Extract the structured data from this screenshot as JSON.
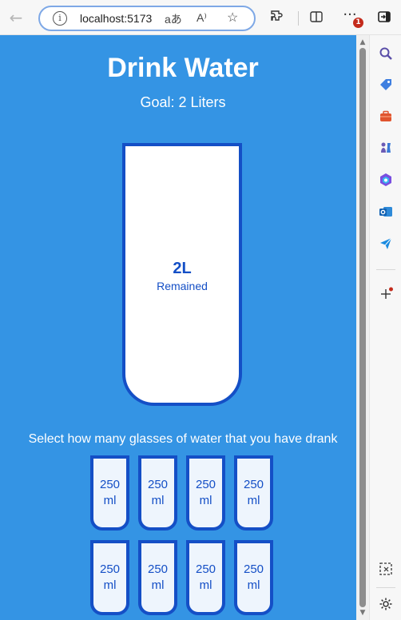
{
  "browser": {
    "url_text": "localhost:5173",
    "read_aloud_icon": "A⁾",
    "translate_icon": "aあ",
    "notification_count": "1",
    "accent_color": "#3494e4"
  },
  "app": {
    "title": "Drink Water",
    "goal": "Goal: 2 Liters",
    "remained_value": "2L",
    "remained_label": "Remained",
    "instruction": "Select how many glasses of water that you have drank",
    "glasses": [
      {
        "line1": "250",
        "line2": "ml"
      },
      {
        "line1": "250",
        "line2": "ml"
      },
      {
        "line1": "250",
        "line2": "ml"
      },
      {
        "line1": "250",
        "line2": "ml"
      },
      {
        "line1": "250",
        "line2": "ml"
      },
      {
        "line1": "250",
        "line2": "ml"
      },
      {
        "line1": "250",
        "line2": "ml"
      },
      {
        "line1": "250",
        "line2": "ml"
      }
    ],
    "colors": {
      "background": "#3494e4",
      "cup_border": "#144fc6",
      "text_dark": "#144fc6"
    }
  },
  "sidebar": {
    "icons": [
      "search-icon",
      "tag-icon",
      "briefcase-icon",
      "chess-icon",
      "copilot-icon",
      "outlook-icon",
      "send-icon",
      "add-icon",
      "screenshot-icon",
      "settings-icon"
    ]
  }
}
